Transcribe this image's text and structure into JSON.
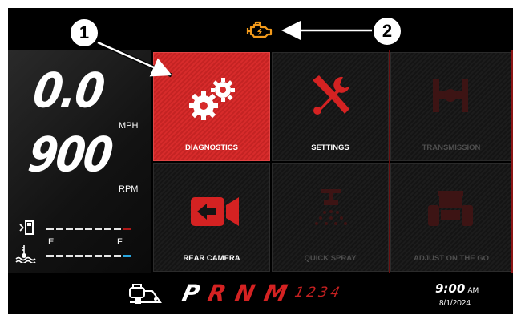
{
  "speed": {
    "value": "0.0",
    "unit": "MPH"
  },
  "rpm": {
    "value": "900",
    "unit": "RPM"
  },
  "fuel_gauge": {
    "empty_label": "E",
    "full_label": "F"
  },
  "tiles": [
    {
      "label": "DIAGNOSTICS",
      "icon": "gears-icon",
      "state": "selected"
    },
    {
      "label": "SETTINGS",
      "icon": "wrench-screwdriver-icon",
      "state": "enabled"
    },
    {
      "label": "TRANSMISSION",
      "icon": "transmission-icon",
      "state": "disabled"
    },
    {
      "label": "REAR CAMERA",
      "icon": "camera-icon",
      "state": "enabled"
    },
    {
      "label": "QUICK SPRAY",
      "icon": "spray-icon",
      "state": "disabled"
    },
    {
      "label": "ADJUST ON THE GO",
      "icon": "tractor-icon",
      "state": "disabled"
    }
  ],
  "gears": {
    "letters": [
      "P",
      "R",
      "N",
      "M"
    ],
    "selected": "P",
    "numbers": "1234"
  },
  "clock": {
    "time": "9:00",
    "ampm": "AM",
    "date": "8/1/2024"
  },
  "callouts": [
    "1",
    "2"
  ],
  "colors": {
    "accent_red": "#d72b2b",
    "warning_orange": "#f39a1b",
    "coolant_blue": "#2aa7e0"
  }
}
